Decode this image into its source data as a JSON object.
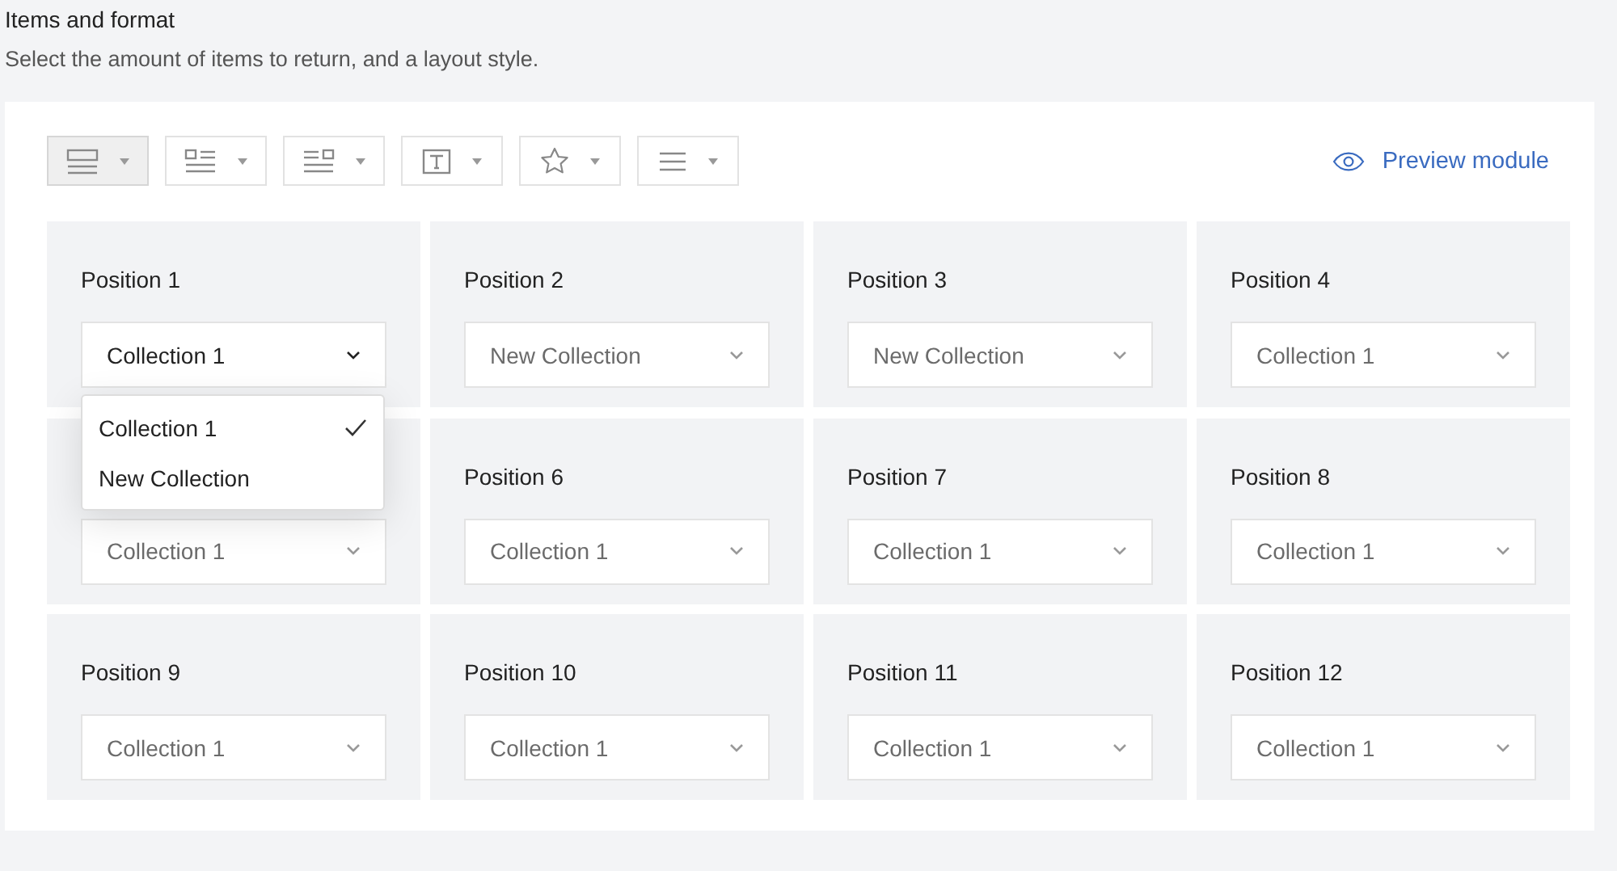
{
  "section": {
    "title": "Items and format",
    "description": "Select the amount of items to return, and a layout style."
  },
  "toolbar": [
    {
      "kind": "stacked",
      "selected": true
    },
    {
      "kind": "image-left",
      "selected": false
    },
    {
      "kind": "image-right",
      "selected": false
    },
    {
      "kind": "text",
      "selected": false
    },
    {
      "kind": "star",
      "selected": false
    },
    {
      "kind": "lines",
      "selected": false
    }
  ],
  "preview_link": "Preview module",
  "positions": [
    {
      "label": "Position 1",
      "value": "Collection 1",
      "open": true,
      "options": [
        {
          "label": "Collection 1",
          "selected": true
        },
        {
          "label": "New Collection",
          "selected": false
        }
      ]
    },
    {
      "label": "Position 2",
      "value": "New Collection",
      "open": false
    },
    {
      "label": "Position 3",
      "value": "New Collection",
      "open": false
    },
    {
      "label": "Position 4",
      "value": "Collection 1",
      "open": false
    },
    {
      "value": "Collection 1",
      "open": false
    },
    {
      "label": "Position 6",
      "value": "Collection 1",
      "open": false
    },
    {
      "label": "Position 7",
      "value": "Collection 1",
      "open": false
    },
    {
      "label": "Position 8",
      "value": "Collection 1",
      "open": false
    },
    {
      "label": "Position 9",
      "value": "Collection 1",
      "open": false
    },
    {
      "label": "Position 10",
      "value": "Collection 1",
      "open": false
    },
    {
      "label": "Position 11",
      "value": "Collection 1",
      "open": false
    },
    {
      "label": "Position 12",
      "value": "Collection 1",
      "open": false
    }
  ]
}
